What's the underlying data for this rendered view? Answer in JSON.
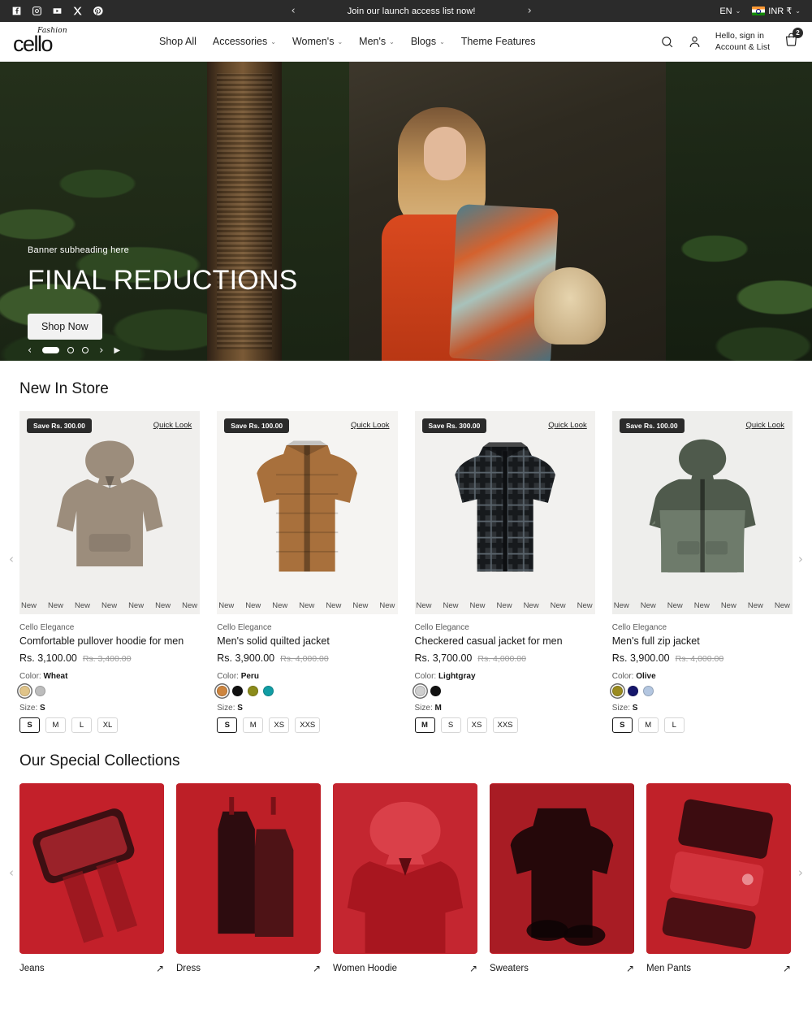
{
  "announcement": {
    "socials": [
      "facebook-icon",
      "instagram-icon",
      "youtube-icon",
      "x-twitter-icon",
      "pinterest-icon"
    ],
    "prev": "‹",
    "text": "Join our launch access list now!",
    "next": "›",
    "language": "EN",
    "currency": "INR ₹",
    "caret": "⌄"
  },
  "header": {
    "logo_script": "Fashion",
    "logo_main": "cello",
    "nav": [
      {
        "label": "Shop All",
        "caret": ""
      },
      {
        "label": "Accessories",
        "caret": "⌄"
      },
      {
        "label": "Women's",
        "caret": "⌄"
      },
      {
        "label": "Men's",
        "caret": "⌄"
      },
      {
        "label": "Blogs",
        "caret": "⌄"
      },
      {
        "label": "Theme Features",
        "caret": ""
      }
    ],
    "account_line1": "Hello, sign in",
    "account_line2": "Account & List",
    "cart_count": "2"
  },
  "hero": {
    "subheading": "Banner subheading here",
    "title": "FINAL REDUCTIONS",
    "cta": "Shop Now",
    "prev": "‹",
    "next": "›",
    "play": "▶",
    "slides": 3,
    "active_slide": 1
  },
  "new_in_store": {
    "title": "New In Store",
    "prev_arrow": "‹",
    "next_arrow": "›",
    "marquee_word": "New",
    "quick_look": "Quick Look",
    "color_prefix": "Color:",
    "size_prefix": "Size:",
    "products": [
      {
        "save_badge": "Save Rs. 300.00",
        "vendor": "Cello Elegance",
        "title": "Comfortable pullover hoodie for men",
        "price": "Rs. 3,100.00",
        "price_old": "Rs. 3,400.00",
        "color": "Wheat",
        "swatches": [
          "#e0c489",
          "#bdbdbd"
        ],
        "selected_swatch": 0,
        "size": "S",
        "sizes": [
          "S",
          "M",
          "L",
          "XL"
        ],
        "selected_size": 0,
        "garment": "hoodie",
        "garment_color": "#9c8d7c",
        "bg": "#f0efed"
      },
      {
        "save_badge": "Save Rs. 100.00",
        "vendor": "Cello Elegance",
        "title": "Men's solid quilted jacket",
        "price": "Rs. 3,900.00",
        "price_old": "Rs. 4,000.00",
        "color": "Peru",
        "swatches": [
          "#cd853f",
          "#111111",
          "#8b8b1a",
          "#119da4"
        ],
        "selected_swatch": 0,
        "size": "S",
        "sizes": [
          "S",
          "M",
          "XS",
          "XXS"
        ],
        "selected_size": 0,
        "garment": "quilted",
        "garment_color": "#a8703c",
        "bg": "#f5f4f2"
      },
      {
        "save_badge": "Save Rs. 300.00",
        "vendor": "Cello Elegance",
        "title": "Checkered casual jacket for men",
        "price": "Rs. 3,700.00",
        "price_old": "Rs. 4,000.00",
        "color": "Lightgray",
        "swatches": [
          "#cfcfcf",
          "#111111"
        ],
        "selected_swatch": 0,
        "size": "M",
        "sizes": [
          "M",
          "S",
          "XS",
          "XXS"
        ],
        "selected_size": 0,
        "garment": "checkered",
        "garment_color": "#2e3236",
        "bg": "#f2f1ef"
      },
      {
        "save_badge": "Save Rs. 100.00",
        "vendor": "Cello Elegance",
        "title": "Men's full zip jacket",
        "price": "Rs. 3,900.00",
        "price_old": "Rs. 4,000.00",
        "color": "Olive",
        "swatches": [
          "#9a8b20",
          "#15166b",
          "#b3c6e0"
        ],
        "selected_swatch": 0,
        "size": "S",
        "sizes": [
          "S",
          "M",
          "L"
        ],
        "selected_size": 0,
        "garment": "zip",
        "garment_color": "#6e7b6b",
        "bg": "#eeeeec"
      }
    ]
  },
  "collections": {
    "title": "Our Special Collections",
    "prev_arrow": "‹",
    "next_arrow": "›",
    "arrow_glyph": "↗",
    "items": [
      {
        "label": "Jeans",
        "tone": "#c3202a"
      },
      {
        "label": "Dress",
        "tone": "#bd1f27"
      },
      {
        "label": "Women Hoodie",
        "tone": "#c42630"
      },
      {
        "label": "Sweaters",
        "tone": "#a81c24"
      },
      {
        "label": "Men Pants",
        "tone": "#c02129"
      }
    ]
  }
}
